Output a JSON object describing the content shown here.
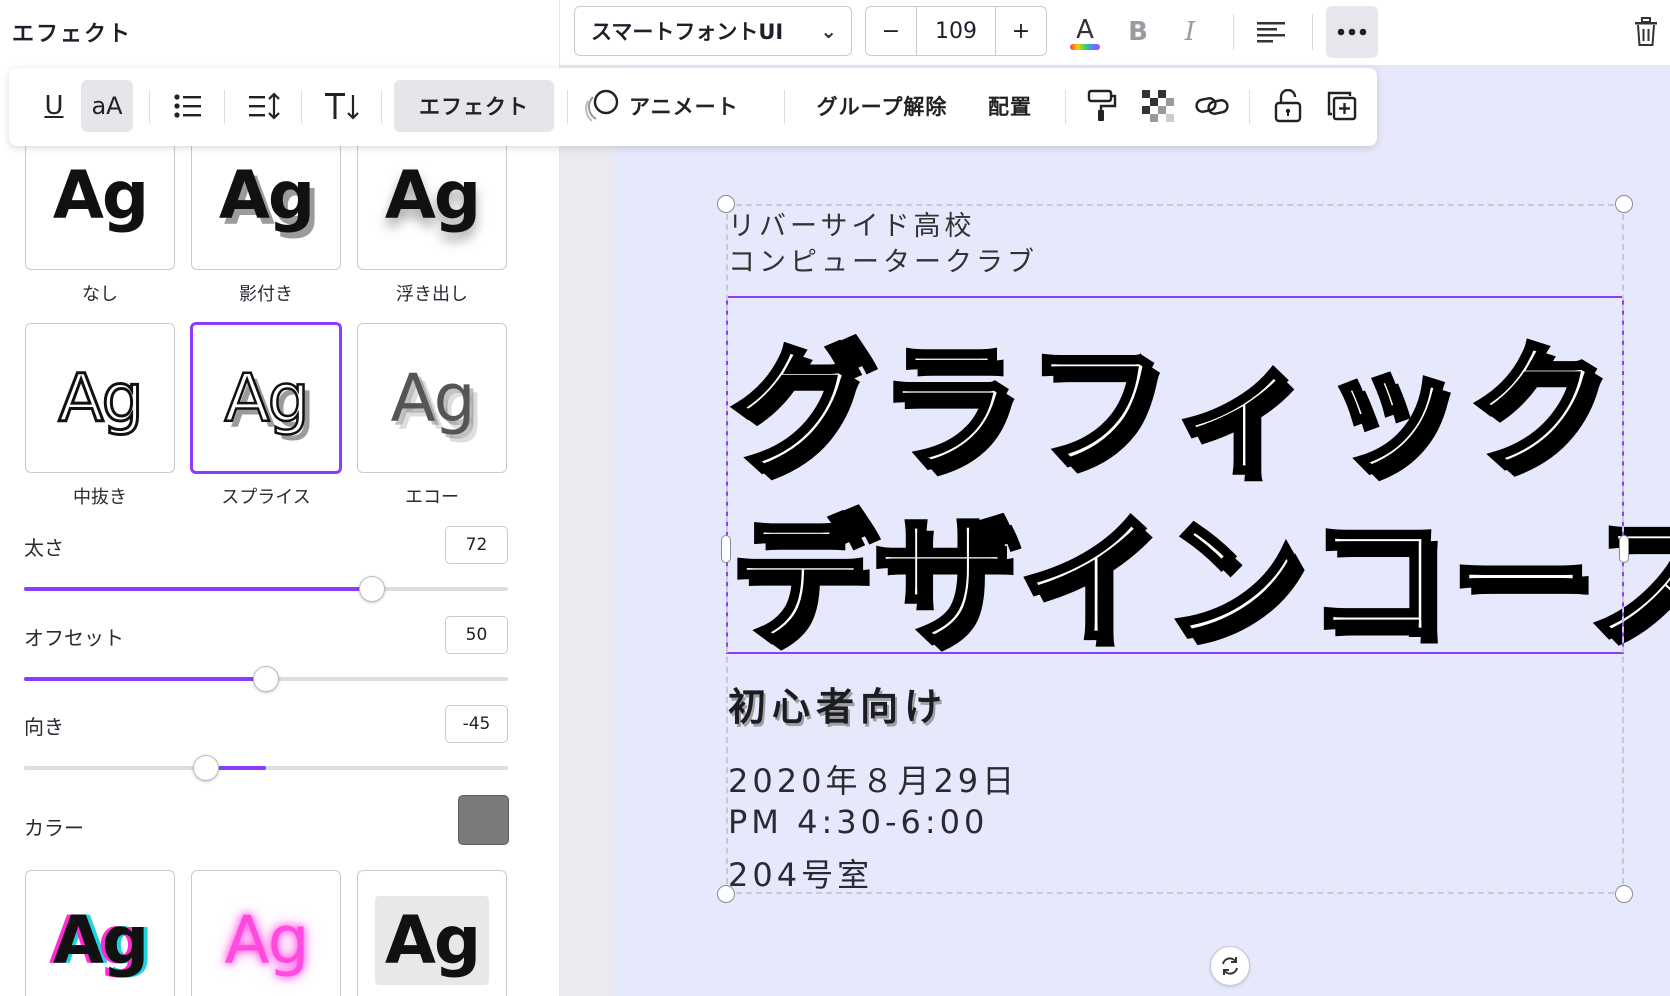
{
  "panel": {
    "title": "エフェクト",
    "effects": [
      {
        "label": "なし",
        "preview": "Ag"
      },
      {
        "label": "影付き",
        "preview": "Ag"
      },
      {
        "label": "浮き出し",
        "preview": "Ag"
      },
      {
        "label": "中抜き",
        "preview": "Ag"
      },
      {
        "label": "スプライス",
        "preview": "Ag",
        "selected": true
      },
      {
        "label": "エコー",
        "preview": "Ag"
      },
      {
        "label": "",
        "preview": "Ag"
      },
      {
        "label": "",
        "preview": "Ag"
      },
      {
        "label": "",
        "preview": "Ag"
      }
    ],
    "controls": {
      "thickness": {
        "label": "太さ",
        "value": "72",
        "level": 72,
        "min": 0,
        "max": 100
      },
      "offset": {
        "label": "オフセット",
        "value": "50",
        "level": 50,
        "min": 0,
        "max": 100
      },
      "direction": {
        "label": "向き",
        "value": "-45",
        "level": -45,
        "min": -180,
        "max": 180
      },
      "color": {
        "label": "カラー",
        "value": "#7b7b7b"
      }
    }
  },
  "toolbar": {
    "font_name": "スマートフォントUI",
    "font_size": "109",
    "minus": "−",
    "plus": "+",
    "icons": [
      "text-color-icon",
      "bold-icon",
      "italic-icon",
      "align-left-icon",
      "more-icon",
      "trash-icon"
    ]
  },
  "float_toolbar": {
    "underline": "U",
    "case": "aA",
    "effects_label": "エフェクト",
    "animate_label": "アニメート",
    "ungroup_label": "グループ解除",
    "arrange_label": "配置"
  },
  "canvas": {
    "school_line1": "リバーサイド高校",
    "school_line2": "コンピュータークラブ",
    "headline_line1": "グラフィック",
    "headline_line2": "デザインコース",
    "subtitle": "初心者向け",
    "date": "2020年８月29日",
    "time": "PM 4:30-6:00",
    "room": "204号室",
    "background_color": "#e6e9fc",
    "selection_color": "#8b3dff"
  }
}
